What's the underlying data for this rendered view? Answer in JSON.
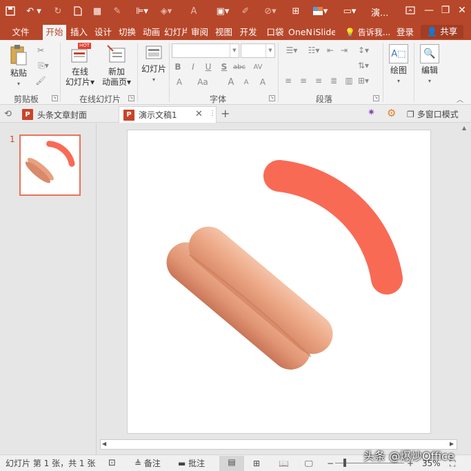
{
  "titlebar": {
    "doc_title": "演...",
    "restore_icon": "restore-icon",
    "accent_color": "#b7472a"
  },
  "tabs": [
    {
      "label": "文件"
    },
    {
      "label": "开始"
    },
    {
      "label": "插入"
    },
    {
      "label": "设计"
    },
    {
      "label": "切换"
    },
    {
      "label": "动画"
    },
    {
      "label": "幻灯片"
    },
    {
      "label": "审阅"
    },
    {
      "label": "视图"
    },
    {
      "label": "开发"
    },
    {
      "label": "口袋"
    },
    {
      "label": "OneN"
    },
    {
      "label": "iSlide"
    }
  ],
  "tell_me": "告诉我...",
  "login": "登录",
  "share": "共享",
  "ribbon": {
    "paste": "粘贴",
    "clipboard_group": "剪贴板",
    "online_slides_line1": "在线",
    "online_slides_line2": "幻灯片",
    "hot_badge": "HOT",
    "new_anim_line1": "新加",
    "new_anim_line2": "动画页",
    "online_group": "在线幻灯片",
    "slides_btn": "幻灯片",
    "font_group": "字体",
    "font_bold": "B",
    "font_italic": "I",
    "font_underline": "U",
    "font_shadow": "S",
    "font_strike": "abc",
    "font_spacing": "AV",
    "font_color": "A",
    "font_case": "Aa",
    "font_grow": "A",
    "font_shrink": "A",
    "font_clear": "A",
    "paragraph_group": "段落",
    "draw": "绘图",
    "edit": "编辑"
  },
  "doc_tabs": [
    {
      "label": "头条文章封面"
    },
    {
      "label": "演示文稿1"
    }
  ],
  "window_mode": "多窗口模式",
  "thumbnail": {
    "number": "1"
  },
  "status": {
    "slide_info": "幻灯片 第 1 张，共 1 张",
    "notes": "备注",
    "comments": "批注",
    "zoom": "35%"
  },
  "watermark": "头条 @爆炒Office",
  "colors": {
    "arc": "#f96a55",
    "sausage": "#e9a07f"
  }
}
